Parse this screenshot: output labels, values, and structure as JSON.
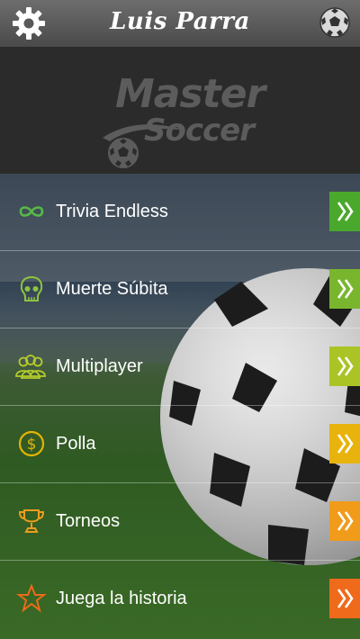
{
  "header": {
    "title": "Luis Parra",
    "settings_icon": "gear-icon",
    "profile_icon": "soccer-ball-icon"
  },
  "logo": {
    "line1": "Master",
    "line2": "Soccer"
  },
  "menu": {
    "items": [
      {
        "label": "Trivia Endless",
        "icon": "infinity-icon",
        "icon_color": "#57b947",
        "button_color": "#4aa82c"
      },
      {
        "label": "Muerte Súbita",
        "icon": "skull-icon",
        "icon_color": "#8dc43f",
        "button_color": "#79b62e"
      },
      {
        "label": "Multiplayer",
        "icon": "group-icon",
        "icon_color": "#b5cc2a",
        "button_color": "#a9c424"
      },
      {
        "label": "Polla",
        "icon": "dollar-coin-icon",
        "icon_color": "#e3b400",
        "button_color": "#e8b30c"
      },
      {
        "label": "Torneos",
        "icon": "trophy-icon",
        "icon_color": "#ef9c1c",
        "button_color": "#f09b1a"
      },
      {
        "label": "Juega la historia",
        "icon": "star-icon",
        "icon_color": "#ec6a1a",
        "button_color": "#ef6a1b"
      }
    ]
  }
}
